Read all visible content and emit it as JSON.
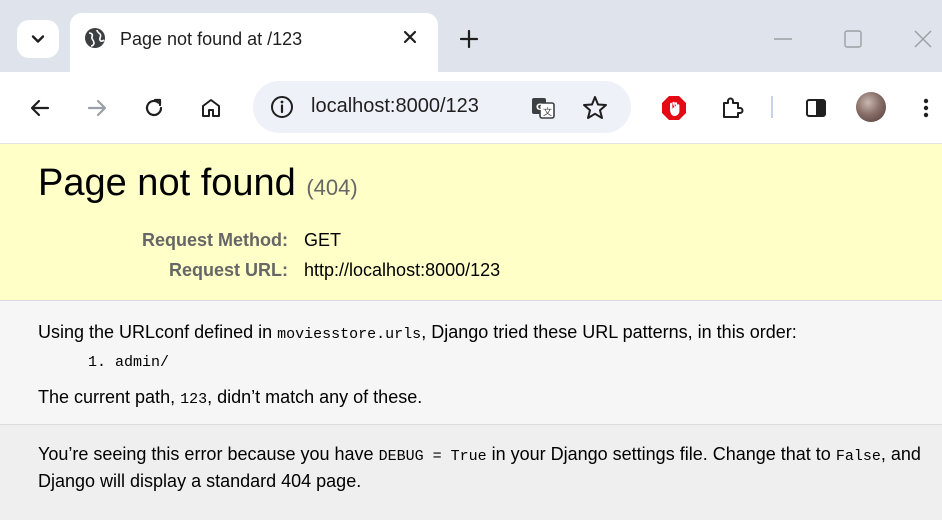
{
  "browser": {
    "tab": {
      "title": "Page not found at /123",
      "favicon": "globe-icon"
    },
    "address_bar": {
      "url": "localhost:8000/123"
    },
    "icons": {
      "tab_search": "chevron-down-icon",
      "tab_close": "close-icon",
      "new_tab": "plus-icon",
      "back": "back-arrow-icon",
      "forward": "forward-arrow-icon",
      "reload": "reload-icon",
      "home": "home-icon",
      "site_info": "info-icon",
      "translate": "translate-icon",
      "bookmark": "star-icon",
      "extension_block": "stop-sign-icon",
      "extensions": "puzzle-icon",
      "side_panel": "side-panel-icon",
      "menu": "kebab-menu-icon"
    },
    "colors": {
      "tabbar": "#dfe3eb",
      "omnibox": "#eef1f7",
      "stop_sign": "#e50914"
    }
  },
  "page": {
    "heading": "Page not found",
    "status_code": "(404)",
    "request_method_label": "Request Method:",
    "request_method_value": "GET",
    "request_url_label": "Request URL:",
    "request_url_value": "http://localhost:8000/123",
    "urlconf_prefix": "Using the URLconf defined in ",
    "urlconf_module": "moviesstore.urls",
    "urlconf_suffix": ", Django tried these URL patterns, in this order:",
    "patterns": [
      "admin/"
    ],
    "current_path_prefix": "The current path, ",
    "current_path": "123",
    "current_path_suffix": ", didn’t match any of these.",
    "explanation_part1": "You’re seeing this error because you have ",
    "explanation_debug": "DEBUG = True",
    "explanation_part2": " in your Django settings file. Change that to ",
    "explanation_false": "False",
    "explanation_part3": ", and Django will display a standard 404 page.",
    "colors": {
      "summary_bg": "#ffffc8",
      "info_bg": "#f6f6f6",
      "explanation_bg": "#efefef"
    }
  }
}
